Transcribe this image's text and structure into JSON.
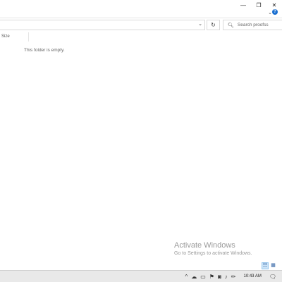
{
  "window_controls": {
    "minimize": "—",
    "maximize": "❐",
    "close": "✕"
  },
  "ribbon": {
    "toggle": "⌄",
    "help": "?"
  },
  "address_bar": {
    "chevron": "⌄",
    "refresh": "↻"
  },
  "search": {
    "placeholder": "Search proofss",
    "icon": "search-icon"
  },
  "columns": {
    "size": "Size"
  },
  "main": {
    "empty_message": "This folder is empty."
  },
  "watermark": {
    "title": "Activate Windows",
    "subtitle": "Go to Settings to activate Windows."
  },
  "view_buttons": {
    "details": "☷",
    "tiles": "▦"
  },
  "taskbar": {
    "tray_icons": [
      "^",
      "☁",
      "▭",
      "⚑",
      "◙",
      "♪",
      "✏"
    ],
    "time": "10:43 AM",
    "notifications": "🗨"
  }
}
